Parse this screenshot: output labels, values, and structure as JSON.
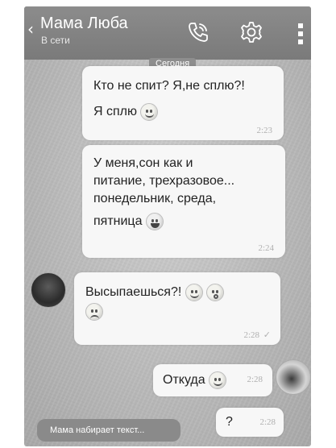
{
  "header": {
    "back_glyph": "‹",
    "contact_name": "Мама Люба",
    "status": "В сети",
    "icons": [
      "phone-call-icon",
      "gear-icon",
      "more-vertical-icon"
    ]
  },
  "date_separator": "Сегодня",
  "messages": [
    {
      "side": "outgoing",
      "lines": [
        "Кто не спит? Я,не сплю?!",
        "Я сплю"
      ],
      "emoji": [
        "smile"
      ],
      "time": "2:23"
    },
    {
      "side": "outgoing",
      "lines": [
        "У меня,сон как и",
        "питание, трехразовое...",
        "понедельник, среда,",
        "пятница"
      ],
      "emoji": [
        "laugh"
      ],
      "time": "2:24"
    },
    {
      "side": "incoming",
      "lines": [
        "Высыпаешься?!"
      ],
      "emoji": [
        "smile",
        "scared",
        "sad"
      ],
      "time": "2:28",
      "tick": "✓"
    },
    {
      "side": "outgoing",
      "lines": [
        "Откуда"
      ],
      "emoji": [
        "smile"
      ],
      "time": "2:28"
    },
    {
      "side": "outgoing",
      "lines": [
        "?"
      ],
      "time": "2:28"
    }
  ],
  "typing_indicator": "Мама набирает текст..."
}
